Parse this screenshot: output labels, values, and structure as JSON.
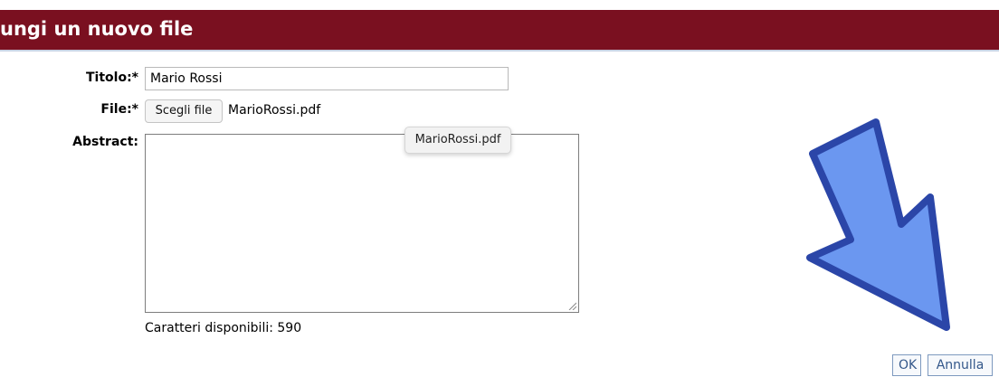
{
  "header": {
    "title": "ungi un nuovo file"
  },
  "form": {
    "title_label": "Titolo:*",
    "title_value": "Mario Rossi",
    "file_label": "File:*",
    "file_button": "Scegli file",
    "file_name": "MarioRossi.pdf",
    "abstract_label": "Abstract:",
    "abstract_value": "",
    "chars_available": "Caratteri disponibili: 590"
  },
  "tooltip": {
    "text": "MarioRossi.pdf"
  },
  "actions": {
    "ok_label": "OK",
    "cancel_label": "Annulla"
  },
  "colors": {
    "header_bg": "#7a1020",
    "arrow_fill": "#6b97f0",
    "arrow_stroke": "#2b46a8",
    "button_text": "#33578a"
  },
  "annotation": {
    "icon": "down-right-arrow-icon"
  }
}
